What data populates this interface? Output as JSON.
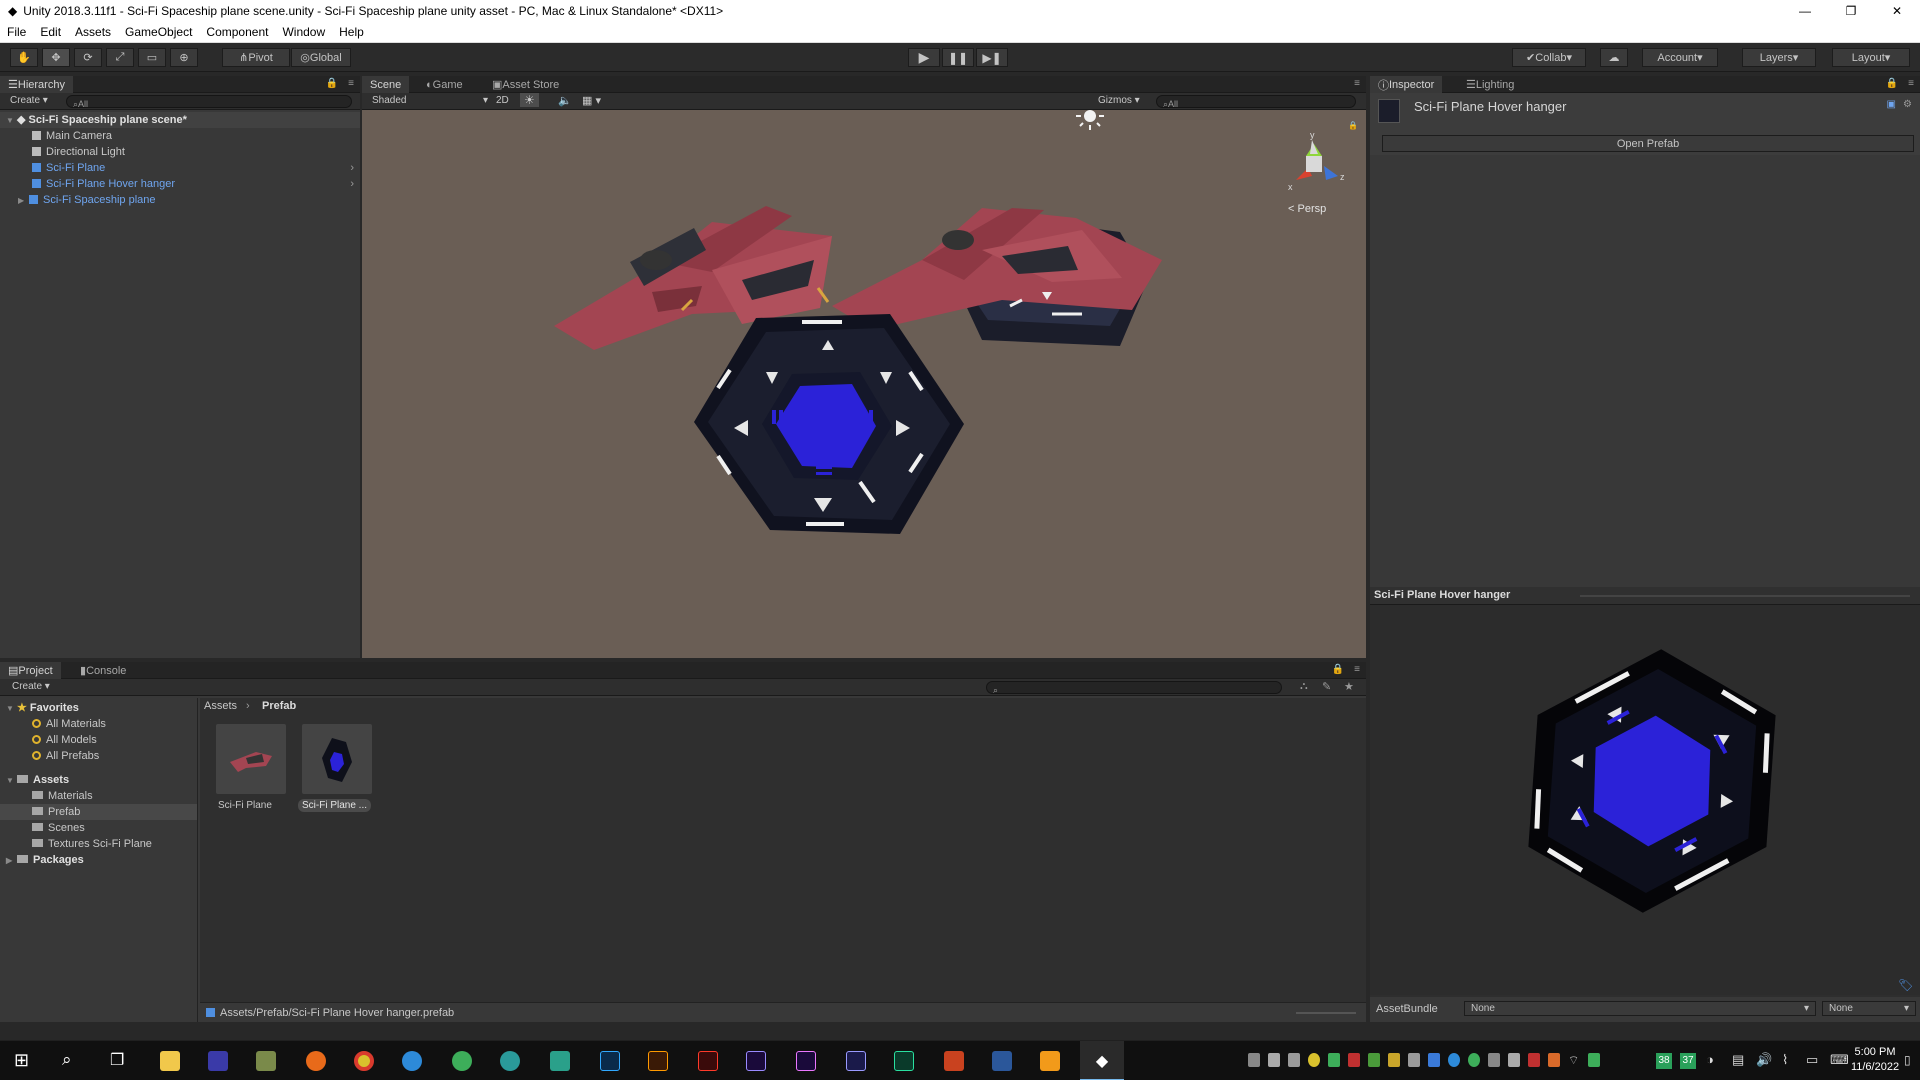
{
  "window": {
    "title": "Unity 2018.3.11f1 - Sci-Fi Spaceship plane scene.unity - Sci-Fi Spaceship plane unity asset - PC, Mac & Linux Standalone* <DX11>"
  },
  "menu": [
    "File",
    "Edit",
    "Assets",
    "GameObject",
    "Component",
    "Window",
    "Help"
  ],
  "toolbar": {
    "pivot": "Pivot",
    "global": "Global",
    "collab": "Collab",
    "account": "Account",
    "layers": "Layers",
    "layout": "Layout"
  },
  "hierarchy": {
    "tab": "Hierarchy",
    "create": "Create",
    "search": "All",
    "scene": "Sci-Fi Spaceship plane scene*",
    "items": [
      "Main Camera",
      "Directional Light",
      "Sci-Fi Plane",
      "Sci-Fi Plane Hover hanger",
      "Sci-Fi Spaceship plane"
    ]
  },
  "sceneview": {
    "tabs": [
      "Scene",
      "Game",
      "Asset Store"
    ],
    "shading": "Shaded",
    "twod": "2D",
    "gizmos": "Gizmos",
    "search": "All",
    "persp": "Persp",
    "axes": {
      "y": "y",
      "x": "x",
      "z": "z"
    }
  },
  "inspector": {
    "tabs": [
      "Inspector",
      "Lighting"
    ],
    "object_name": "Sci-Fi Plane Hover hanger",
    "open_prefab": "Open Prefab",
    "preview_title": "Sci-Fi Plane Hover hanger",
    "assetbundle_label": "AssetBundle",
    "assetbundle_value": "None",
    "assetbundle_variant": "None"
  },
  "project": {
    "tabs": [
      "Project",
      "Console"
    ],
    "create": "Create",
    "favorites": "Favorites",
    "fav_items": [
      "All Materials",
      "All Models",
      "All Prefabs"
    ],
    "assets": "Assets",
    "asset_items": [
      "Materials",
      "Prefab",
      "Scenes",
      "Textures Sci-Fi Plane"
    ],
    "packages": "Packages",
    "breadcrumb": [
      "Assets",
      "Prefab"
    ],
    "files": [
      "Sci-Fi Plane",
      "Sci-Fi Plane ..."
    ],
    "status_path": "Assets/Prefab/Sci-Fi Plane Hover hanger.prefab"
  },
  "taskbar": {
    "time": "5:00 PM",
    "date": "11/6/2022",
    "badge1": "38",
    "badge2": "37"
  },
  "colors": {
    "accent": "#3e6dcf",
    "hex_blue": "#2b22d8",
    "ship_red": "#a34552",
    "scene_bg": "#6a5e55"
  }
}
